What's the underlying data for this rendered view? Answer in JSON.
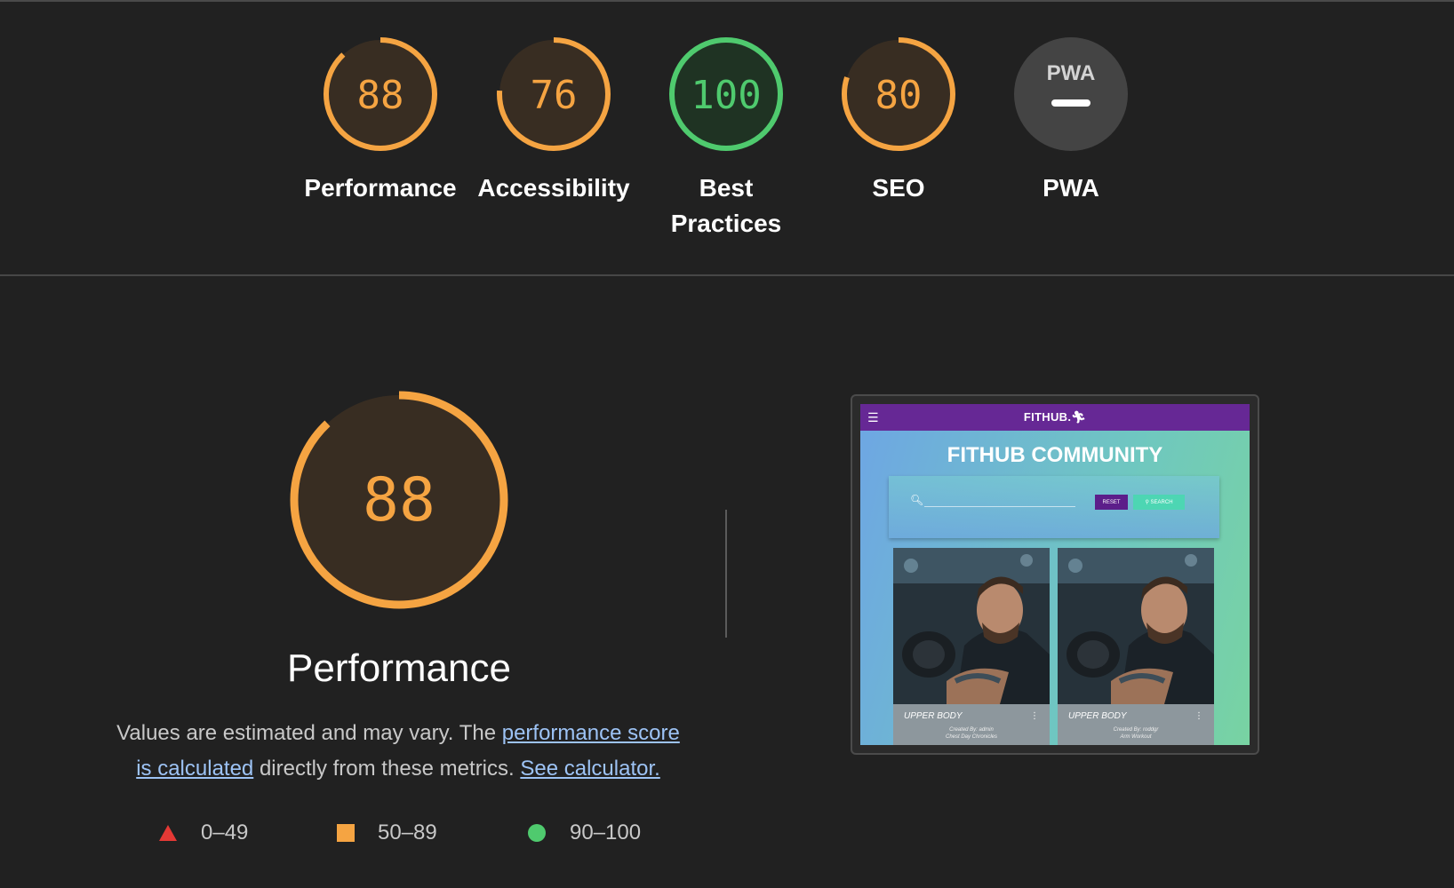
{
  "categories": [
    {
      "key": "performance",
      "score": "88",
      "label_line1": "Performance",
      "label_line2": "",
      "color": "#f5a442",
      "fraction": 0.88
    },
    {
      "key": "accessibility",
      "score": "76",
      "label_line1": "Accessibility",
      "label_line2": "",
      "color": "#f5a442",
      "fraction": 0.76
    },
    {
      "key": "best-practices",
      "score": "100",
      "label_line1": "Best",
      "label_line2": "Practices",
      "color": "#4fca6e",
      "fraction": 1.0
    },
    {
      "key": "seo",
      "score": "80",
      "label_line1": "SEO",
      "label_line2": "",
      "color": "#f5a442",
      "fraction": 0.8
    },
    {
      "key": "pwa",
      "score": "",
      "label_line1": "PWA",
      "label_line2": "",
      "badge": "PWA",
      "color": "#444444",
      "fraction": 0
    }
  ],
  "main": {
    "score": "88",
    "fraction": 0.88,
    "title": "Performance",
    "desc_before": "Values are estimated and may vary. The ",
    "desc_link1": "performance score is calculated",
    "desc_middle": " directly from these metrics. ",
    "desc_link2": "See calculator."
  },
  "legend": [
    {
      "shape": "triangle",
      "color": "#e53935",
      "range": "0–49"
    },
    {
      "shape": "square",
      "color": "#f5a442",
      "range": "50–89"
    },
    {
      "shape": "circle",
      "color": "#4fca6e",
      "range": "90–100"
    }
  ],
  "preview": {
    "brand": "FITHUB.",
    "heading": "FITHUB COMMUNITY",
    "reset": "RESET",
    "search": "SEARCH",
    "search_icon": "magnifier-icon",
    "cards": [
      {
        "title": "UPPER BODY",
        "created": "Created By: admin",
        "sub": "Chest Day Chronicles"
      },
      {
        "title": "UPPER BODY",
        "created": "Created By: roddgr",
        "sub": "Arm Workout"
      }
    ]
  },
  "colors": {
    "average": "#f5a442",
    "pass": "#4fca6e",
    "fail": "#e53935",
    "average_fill": "#382d22",
    "pass_fill": "#1f3323"
  }
}
